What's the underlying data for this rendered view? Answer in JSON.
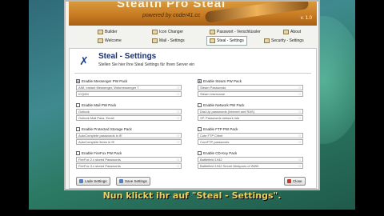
{
  "banner": {
    "title": "Stealth Pro Steal",
    "subtitle": "powered by coder41.cc",
    "version": "v. 1.0"
  },
  "tabs": [
    {
      "label": "Builder"
    },
    {
      "label": "Icon Changer"
    },
    {
      "label": "Passwort - Verschlüssler"
    },
    {
      "label": "About"
    },
    {
      "label": "Welcome"
    },
    {
      "label": "Mail - Settings"
    },
    {
      "label": "Steal - Settings"
    },
    {
      "label": "Security - Settings"
    }
  ],
  "header": {
    "title": "Steal - Settings",
    "subtitle": "Stellen Sie hier Ihre Steal Settings für Ihren Server ein"
  },
  "groups": [
    {
      "label": "Enable Messenger PW Pack",
      "checked": true,
      "items": [
        "AIM, Instant Messenger, Webmessenger 7",
        "ICQ/IM"
      ]
    },
    {
      "label": "Enable Steam PW Pack",
      "checked": true,
      "items": [
        "Steam Passwords",
        "Steam Username"
      ]
    },
    {
      "label": "Enable Mail PW Pack",
      "checked": false,
      "items": [
        "Outlook",
        "Outlook Mail Pass, Email"
      ]
    },
    {
      "label": "Enable Network PW Pack",
      "checked": false,
      "items": [
        "Dial-Up passwords (Internet and RAS)",
        "XP, Passwords network info"
      ]
    },
    {
      "label": "Enable Protected Storage Pack",
      "checked": false,
      "items": [
        "AutoComplete passwords in IE",
        "AutoComplete items in IE"
      ]
    },
    {
      "label": "Enable FTP PW Pack",
      "checked": false,
      "items": [
        "Cute FTP Client",
        "CoreFTP passwords"
      ]
    },
    {
      "label": "Enable FireFox PW Pack",
      "checked": false,
      "items": [
        "FireFox 2.x stored Passwords",
        "FireFox 3.x stored Passwords"
      ]
    },
    {
      "label": "Enable CD-Key Pack",
      "checked": false,
      "items": [
        "Battlefield 1942",
        "Battlefield 1942 Secret Weapons of WWII"
      ]
    }
  ],
  "buttons": {
    "load": "Lade Settings",
    "save": "Save Settings",
    "close": "Close"
  },
  "caption": "Nun klickt ihr auf \"Steal - Settings\"."
}
